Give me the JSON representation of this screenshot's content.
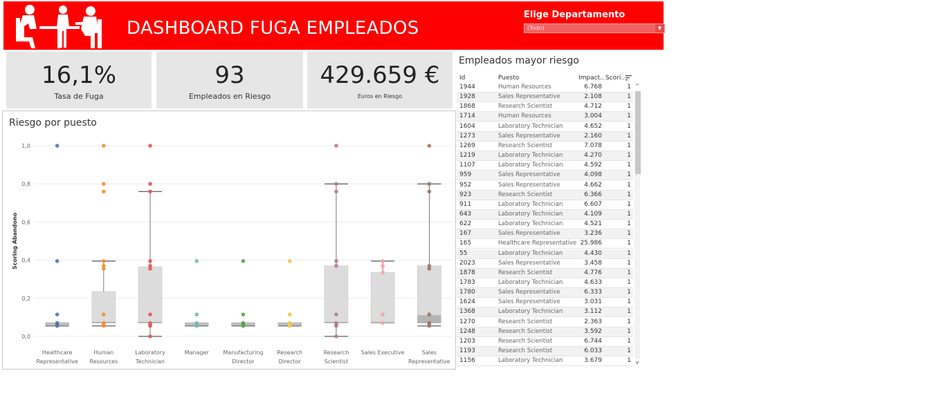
{
  "header": {
    "title": "DASHBOARD FUGA EMPLEADOS",
    "filter_label": "Elige Departamento",
    "filter_value": "(Todo)",
    "logo_icon": "office-workers-silhouette-icon",
    "colors": {
      "brand": "#ff0000",
      "card": "#e6e6e6"
    }
  },
  "kpis": [
    {
      "value": "16,1%",
      "label": "Tasa de Fuga"
    },
    {
      "value": "93",
      "label": "Empleados en Riesgo"
    },
    {
      "value": "429.659 €",
      "label": "Euros en Riesgo"
    }
  ],
  "chart_data": {
    "type": "boxplot",
    "title": "Riesgo por puesto",
    "ylabel": "Scoring Abandono",
    "ylim": [
      0,
      1
    ],
    "yticks": [
      "0,0",
      "0,2",
      "0,4",
      "0,6",
      "0,8",
      "1,0"
    ],
    "categories": [
      {
        "label": [
          "Healthcare",
          "Representative"
        ],
        "color": "#4e79a7",
        "box": {
          "whisker_low": 0.055,
          "q1": 0.06,
          "median": 0.065,
          "q3": 0.07,
          "whisker_high": 0.07
        },
        "points": [
          1.0,
          0.395,
          0.115,
          0.07,
          0.065,
          0.06,
          0.055
        ]
      },
      {
        "label": [
          "Human",
          "Resources"
        ],
        "color": "#f28e2b",
        "box": {
          "whisker_low": 0.055,
          "q1": 0.07,
          "median": 0.075,
          "q3": 0.235,
          "whisker_high": 0.395
        },
        "points": [
          1.0,
          0.8,
          0.76,
          0.395,
          0.37,
          0.355,
          0.115,
          0.07,
          0.065,
          0.06,
          0.055
        ]
      },
      {
        "label": [
          "Laboratory",
          "Technician"
        ],
        "color": "#e15759",
        "box": {
          "whisker_low": 0.0,
          "q1": 0.07,
          "median": 0.075,
          "q3": 0.365,
          "whisker_high": 0.76
        },
        "points": [
          1.0,
          0.8,
          0.76,
          0.395,
          0.37,
          0.355,
          0.115,
          0.07,
          0.06,
          0.055,
          0.0
        ]
      },
      {
        "label": [
          "Manager"
        ],
        "color": "#76b7b2",
        "box": {
          "whisker_low": 0.055,
          "q1": 0.06,
          "median": 0.065,
          "q3": 0.07,
          "whisker_high": 0.07
        },
        "points": [
          0.395,
          0.115,
          0.07,
          0.065,
          0.06,
          0.055
        ]
      },
      {
        "label": [
          "Manufacturing",
          "Director"
        ],
        "color": "#59a14f",
        "box": {
          "whisker_low": 0.055,
          "q1": 0.06,
          "median": 0.065,
          "q3": 0.07,
          "whisker_high": 0.07
        },
        "points": [
          0.395,
          0.115,
          0.07,
          0.065,
          0.06,
          0.055
        ]
      },
      {
        "label": [
          "Research",
          "Director"
        ],
        "color": "#edc948",
        "box": {
          "whisker_low": 0.055,
          "q1": 0.06,
          "median": 0.065,
          "q3": 0.07,
          "whisker_high": 0.07
        },
        "points": [
          0.395,
          0.115,
          0.07,
          0.065,
          0.06,
          0.055
        ]
      },
      {
        "label": [
          "Research",
          "Scientist"
        ],
        "color": "#b07aa1",
        "box": {
          "whisker_low": 0.0,
          "q1": 0.07,
          "median": 0.075,
          "q3": 0.37,
          "whisker_high": 0.8
        },
        "points": [
          1.0,
          0.8,
          0.76,
          0.395,
          0.37,
          0.115,
          0.07,
          0.06,
          0.055,
          0.0
        ]
      },
      {
        "label": [
          "Sales Executive"
        ],
        "color": "#ff9da7",
        "box": {
          "whisker_low": 0.07,
          "q1": 0.07,
          "median": 0.075,
          "q3": 0.335,
          "whisker_high": 0.395
        },
        "points": [
          0.395,
          0.37,
          0.335,
          0.115,
          0.07
        ]
      },
      {
        "label": [
          "Sales",
          "Representative"
        ],
        "color": "#9c755f",
        "box": {
          "whisker_low": 0.055,
          "q1": 0.07,
          "median": 0.11,
          "q3": 0.37,
          "whisker_high": 0.8
        },
        "points": [
          1.0,
          0.8,
          0.76,
          0.37,
          0.355,
          0.115,
          0.07,
          0.065,
          0.055
        ]
      }
    ]
  },
  "table": {
    "title": "Empleados mayor riesgo",
    "headers": {
      "id": "Id",
      "puesto": "Puesto",
      "impacto": "Impact..",
      "scoring": "Scori.."
    },
    "sort_icon": "sort-descending-icon",
    "rows": [
      [
        "1944",
        "Human Resources",
        "6.768",
        "1"
      ],
      [
        "1928",
        "Sales Representative",
        "2.108",
        "1"
      ],
      [
        "1868",
        "Research Scientist",
        "4.712",
        "1"
      ],
      [
        "1714",
        "Human Resources",
        "3.004",
        "1"
      ],
      [
        "1604",
        "Laboratory Technician",
        "4.652",
        "1"
      ],
      [
        "1273",
        "Sales Representative",
        "2.160",
        "1"
      ],
      [
        "1269",
        "Research Scientist",
        "7.078",
        "1"
      ],
      [
        "1219",
        "Laboratory Technician",
        "4.270",
        "1"
      ],
      [
        "1107",
        "Laboratory Technician",
        "4.592",
        "1"
      ],
      [
        "959",
        "Sales Representative",
        "4.098",
        "1"
      ],
      [
        "952",
        "Sales Representative",
        "4.662",
        "1"
      ],
      [
        "923",
        "Research Scientist",
        "6.366",
        "1"
      ],
      [
        "911",
        "Laboratory Technician",
        "6.607",
        "1"
      ],
      [
        "643",
        "Laboratory Technician",
        "4.109",
        "1"
      ],
      [
        "622",
        "Laboratory Technician",
        "4.521",
        "1"
      ],
      [
        "167",
        "Sales Representative",
        "3.236",
        "1"
      ],
      [
        "165",
        "Healthcare Representative",
        "25.986",
        "1"
      ],
      [
        "55",
        "Laboratory Technician",
        "4.430",
        "1"
      ],
      [
        "2023",
        "Sales Representative",
        "3.458",
        "1"
      ],
      [
        "1878",
        "Research Scientist",
        "4.776",
        "1"
      ],
      [
        "1783",
        "Laboratory Technician",
        "4.633",
        "1"
      ],
      [
        "1780",
        "Sales Representative",
        "6.333",
        "1"
      ],
      [
        "1624",
        "Sales Representative",
        "3.031",
        "1"
      ],
      [
        "1368",
        "Laboratory Technician",
        "3.112",
        "1"
      ],
      [
        "1270",
        "Research Scientist",
        "2.363",
        "1"
      ],
      [
        "1248",
        "Research Scientist",
        "3.592",
        "1"
      ],
      [
        "1203",
        "Research Scientist",
        "6.744",
        "1"
      ],
      [
        "1193",
        "Research Scientist",
        "6.033",
        "1"
      ],
      [
        "1156",
        "Laboratory Technician",
        "3.679",
        "1"
      ]
    ]
  }
}
